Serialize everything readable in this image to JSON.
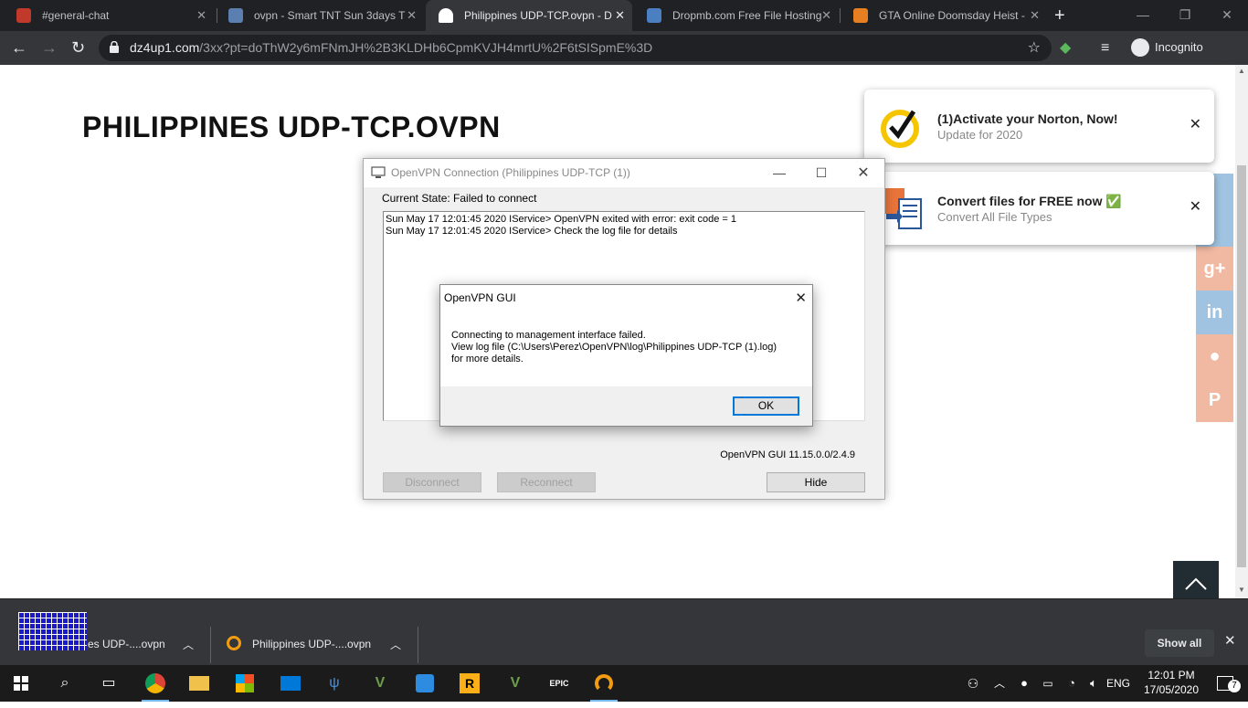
{
  "browser": {
    "tabs": [
      {
        "label": "#general-chat",
        "fav_color": "#c0392b"
      },
      {
        "label": "ovpn - Smart TNT Sun 3days T",
        "fav_color": "#5a7fb0"
      },
      {
        "label": "Philippines UDP-TCP.ovpn - D",
        "fav_color": "#ffffff",
        "active": true
      },
      {
        "label": "Dropmb.com Free File Hosting",
        "fav_color": "#4a7fc1"
      },
      {
        "label": "GTA Online Doomsday Heist -",
        "fav_color": "#e67e22"
      }
    ],
    "address": {
      "host": "dz4up1.com",
      "path": "/3xx?pt=doThW2y6mFNmJH%2B3KLDHb6CpmKVJH4mrtU%2F6tSISpmE%3D"
    },
    "incognito_label": "Incognito"
  },
  "page": {
    "title": "PHILIPPINES UDP-TCP.OVPN",
    "social": [
      {
        "glyph": "g+",
        "color": "#f1b9a2"
      },
      {
        "glyph": "in",
        "color": "#9fc3e0"
      },
      {
        "glyph": "●",
        "color": "#f1b9a2"
      },
      {
        "glyph": "P",
        "color": "#f1b9a2"
      }
    ]
  },
  "notifications": [
    {
      "title": "(1)Activate your Norton, Now!",
      "subtitle": "Update for 2020"
    },
    {
      "title": "Convert files for FREE now ✅",
      "subtitle": "Convert All File Types"
    }
  ],
  "openvpn": {
    "window_title": "OpenVPN Connection (Philippines UDP-TCP (1))",
    "state": "Current State: Failed to connect",
    "log": [
      "Sun May 17 12:01:45 2020 IService> OpenVPN exited with error: exit code = 1",
      "Sun May 17 12:01:45 2020 IService> Check the log file for details"
    ],
    "version": "OpenVPN GUI 11.15.0.0/2.4.9",
    "disconnect": "Disconnect",
    "reconnect": "Reconnect",
    "hide": "Hide"
  },
  "dialog": {
    "title": "OpenVPN GUI",
    "line1": "Connecting to management interface failed.",
    "line2": "View log file (C:\\Users\\Perez\\OpenVPN\\log\\Philippines UDP-TCP (1).log)",
    "line3": "for more details.",
    "ok": "OK"
  },
  "downloads": {
    "items": [
      "es UDP-....ovpn",
      "Philippines UDP-....ovpn"
    ],
    "show_all": "Show all"
  },
  "taskbar": {
    "lang": "ENG",
    "time": "12:01 PM",
    "date": "17/05/2020",
    "notif_count": "7"
  }
}
